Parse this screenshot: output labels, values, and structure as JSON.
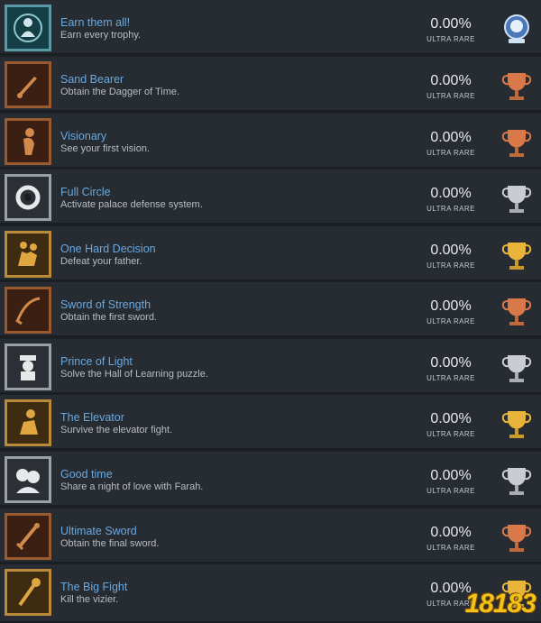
{
  "trophies": [
    {
      "title": "Earn them all!",
      "desc": "Earn every trophy.",
      "percent": "0.00%",
      "rarity": "ULTRA RARE",
      "grade": "platinum",
      "icon": "medal-icon"
    },
    {
      "title": "Sand Bearer",
      "desc": "Obtain the Dagger of Time.",
      "percent": "0.00%",
      "rarity": "ULTRA RARE",
      "grade": "bronze",
      "icon": "dagger-icon"
    },
    {
      "title": "Visionary",
      "desc": "See your first vision.",
      "percent": "0.00%",
      "rarity": "ULTRA RARE",
      "grade": "bronze",
      "icon": "figure-icon"
    },
    {
      "title": "Full Circle",
      "desc": "Activate palace defense system.",
      "percent": "0.00%",
      "rarity": "ULTRA RARE",
      "grade": "silver",
      "icon": "ring-icon"
    },
    {
      "title": "One Hard Decision",
      "desc": "Defeat your father.",
      "percent": "0.00%",
      "rarity": "ULTRA RARE",
      "grade": "gold",
      "icon": "fight-icon"
    },
    {
      "title": "Sword of Strength",
      "desc": "Obtain the first sword.",
      "percent": "0.00%",
      "rarity": "ULTRA RARE",
      "grade": "bronze",
      "icon": "sword-icon"
    },
    {
      "title": "Prince of Light",
      "desc": "Solve the Hall of Learning puzzle.",
      "percent": "0.00%",
      "rarity": "ULTRA RARE",
      "grade": "silver",
      "icon": "statue-icon"
    },
    {
      "title": "The Elevator",
      "desc": "Survive the elevator fight.",
      "percent": "0.00%",
      "rarity": "ULTRA RARE",
      "grade": "gold",
      "icon": "crouch-icon"
    },
    {
      "title": "Good time",
      "desc": "Share a night of love with Farah.",
      "percent": "0.00%",
      "rarity": "ULTRA RARE",
      "grade": "silver",
      "icon": "couple-icon"
    },
    {
      "title": "Ultimate Sword",
      "desc": "Obtain the final sword.",
      "percent": "0.00%",
      "rarity": "ULTRA RARE",
      "grade": "bronze",
      "icon": "sword-icon"
    },
    {
      "title": "The Big Fight",
      "desc": "Kill the vizier.",
      "percent": "0.00%",
      "rarity": "ULTRA RARE",
      "grade": "gold",
      "icon": "staff-icon"
    }
  ],
  "colors": {
    "platinum": "#cfe2f5",
    "gold": "#e8b53a",
    "silver": "#c9ccd0",
    "bronze": "#d9794a",
    "title": "#6aa8de"
  },
  "watermark": "18183"
}
